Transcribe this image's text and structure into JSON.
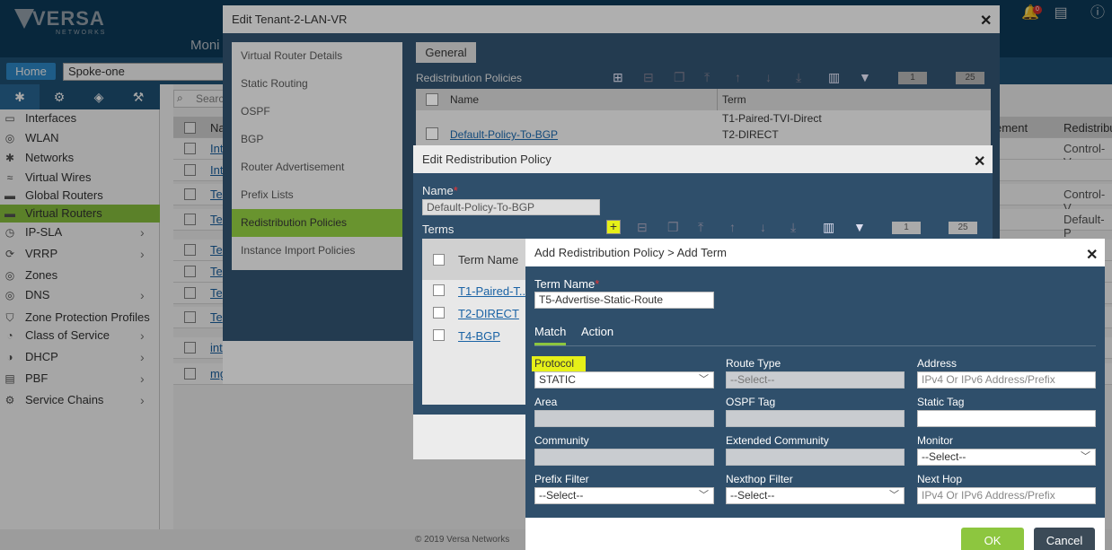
{
  "brand": {
    "name": "VERSA",
    "sub": "NETWORKS",
    "bell_count": "0"
  },
  "top_nav": {
    "monitor": "Moni"
  },
  "nav": {
    "home_label": "Home",
    "appliance": "Spoke-one"
  },
  "sidebar": {
    "tab_icons": [
      "network-icon",
      "gear-icon",
      "cube-icon",
      "config-icon"
    ],
    "items": [
      {
        "label": "Interfaces",
        "icon": "interfaces-icon",
        "chevron": false,
        "active": false
      },
      {
        "label": "WLAN",
        "icon": "wlan-icon",
        "chevron": false,
        "active": false
      },
      {
        "label": "Networks",
        "icon": "networks-icon",
        "chevron": false,
        "active": false
      },
      {
        "label": "Virtual Wires",
        "icon": "wire-icon",
        "chevron": false,
        "active": false
      },
      {
        "label": "Global Routers",
        "icon": "router-icon",
        "chevron": false,
        "active": false
      },
      {
        "label": "Virtual Routers",
        "icon": "router-icon",
        "chevron": false,
        "active": true
      },
      {
        "label": "IP-SLA",
        "icon": "ipsla-icon",
        "chevron": true,
        "active": false
      },
      {
        "label": "VRRP",
        "icon": "vrrp-icon",
        "chevron": true,
        "active": false
      },
      {
        "label": "Zones",
        "icon": "zones-icon",
        "chevron": false,
        "active": false
      },
      {
        "label": "DNS",
        "icon": "dns-icon",
        "chevron": true,
        "active": false
      },
      {
        "label": "Zone Protection Profiles",
        "icon": "shield-icon",
        "chevron": false,
        "active": false
      },
      {
        "label": "Class of Service",
        "icon": "cos-icon",
        "chevron": true,
        "active": false
      },
      {
        "label": "DHCP",
        "icon": "dhcp-icon",
        "chevron": true,
        "active": false
      },
      {
        "label": "PBF",
        "icon": "pbf-icon",
        "chevron": true,
        "active": false
      },
      {
        "label": "Service Chains",
        "icon": "gear-icon",
        "chevron": true,
        "active": false
      }
    ]
  },
  "bg_table": {
    "search_placeholder": "Searc",
    "header_name": "Na",
    "header_right1": "ement",
    "header_right2": "Redistribu",
    "rows": [
      {
        "name": "Int",
        "right": "Control-V"
      },
      {
        "name": "Int",
        "right": ""
      },
      {
        "name": "Te",
        "right": "Control-V"
      },
      {
        "name": "Te",
        "right": "Default-P"
      },
      {
        "name": "Te",
        "right": ""
      },
      {
        "name": "Te",
        "right": ""
      },
      {
        "name": "Te",
        "right": ""
      },
      {
        "name": "Te",
        "right": ""
      },
      {
        "name": "int",
        "right": ""
      },
      {
        "name": "mg",
        "right": ""
      }
    ]
  },
  "footer": {
    "copyright": "© 2019 Versa Networks"
  },
  "tenant_modal": {
    "title": "Edit Tenant-2-LAN-VR",
    "nav": [
      "Virtual Router Details",
      "Static Routing",
      "OSPF",
      "BGP",
      "Router Advertisement",
      "Prefix Lists",
      "Redistribution Policies",
      "Instance Import Policies"
    ],
    "active_nav_index": 6,
    "general_tab": "General",
    "section_title": "Redistribution Policies",
    "page": "1",
    "page_size": "25",
    "col_name": "Name",
    "col_term": "Term",
    "rows": [
      {
        "name": "Default-Policy-To-BGP",
        "terms": [
          "T1-Paired-TVI-Direct",
          "T2-DIRECT"
        ]
      }
    ]
  },
  "redist_modal": {
    "title": "Edit Redistribution Policy",
    "name_label": "Name",
    "name_value": "Default-Policy-To-BGP",
    "terms_label": "Terms",
    "col_term_name": "Term Name",
    "page": "1",
    "page_size": "25",
    "terms": [
      "T1-Paired-T...",
      "T2-DIRECT",
      "T4-BGP"
    ]
  },
  "term_modal": {
    "title": "Add Redistribution Policy > Add Term",
    "term_name_label": "Term Name",
    "term_name_value": "T5-Advertise-Static-Route",
    "tabs": {
      "match": "Match",
      "action": "Action"
    },
    "fields": {
      "protocol": {
        "label": "Protocol",
        "value": "STATIC"
      },
      "route_type": {
        "label": "Route Type",
        "value": "--Select--"
      },
      "address": {
        "label": "Address",
        "placeholder": "IPv4 Or IPv6 Address/Prefix"
      },
      "area": {
        "label": "Area",
        "value": ""
      },
      "ospf_tag": {
        "label": "OSPF Tag",
        "value": ""
      },
      "static_tag": {
        "label": "Static Tag",
        "value": ""
      },
      "community": {
        "label": "Community",
        "value": ""
      },
      "extended_community": {
        "label": "Extended Community",
        "value": ""
      },
      "monitor": {
        "label": "Monitor",
        "value": "--Select--"
      },
      "prefix_filter": {
        "label": "Prefix Filter",
        "value": "--Select--"
      },
      "nexthop_filter": {
        "label": "Nexthop Filter",
        "value": "--Select--"
      },
      "next_hop": {
        "label": "Next Hop",
        "placeholder": "IPv4 Or IPv6 Address/Prefix"
      }
    },
    "ok_label": "OK",
    "cancel_label": "Cancel"
  },
  "colors": {
    "accent_green": "#8dc63f",
    "modal_blue": "#2f4f6b",
    "highlight_yellow": "#e6f018",
    "link_blue": "#1a63a5"
  }
}
